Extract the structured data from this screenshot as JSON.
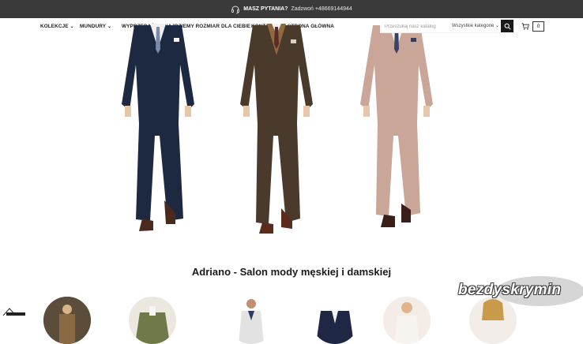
{
  "topbar": {
    "question": "MASZ PYTANIA?",
    "call": "Zadzwoń +48669144944",
    "icon": "headset-icon"
  },
  "nav": {
    "items": [
      {
        "label": "KOLEKCJE",
        "has_dropdown": true
      },
      {
        "label": "MUNDURY",
        "has_dropdown": true
      },
      {
        "label": "WYPRZEDAŻ",
        "has_dropdown": false
      },
      {
        "label": "ZNAJDZIEMY ROZMIAR DLA CIEBIE",
        "has_dropdown": false
      },
      {
        "label": "KONTAKT",
        "has_dropdown": false
      },
      {
        "label": "STRONA GŁÓWNA",
        "has_dropdown": false
      }
    ]
  },
  "search": {
    "placeholder": "Przeszukaj nasz katalog",
    "category": "Wszystkie kategorie",
    "button_icon": "search-icon"
  },
  "cart": {
    "count": "0",
    "icon": "cart-icon"
  },
  "hero": {
    "suits": [
      {
        "name": "navy-double-breasted-suit",
        "color": "#1d2940"
      },
      {
        "name": "brown-three-piece-suit",
        "color": "#4a3a2c"
      },
      {
        "name": "beige-pink-suit",
        "color": "#c9a697"
      }
    ]
  },
  "section": {
    "title": "Adriano - Salon mody męskiej i damskiej"
  },
  "watermark": {
    "text": "bezdyskrymin"
  },
  "colors": {
    "topbar_bg": "#3a3a3a",
    "text": "#222222",
    "accent_dark": "#1a1a1a"
  }
}
